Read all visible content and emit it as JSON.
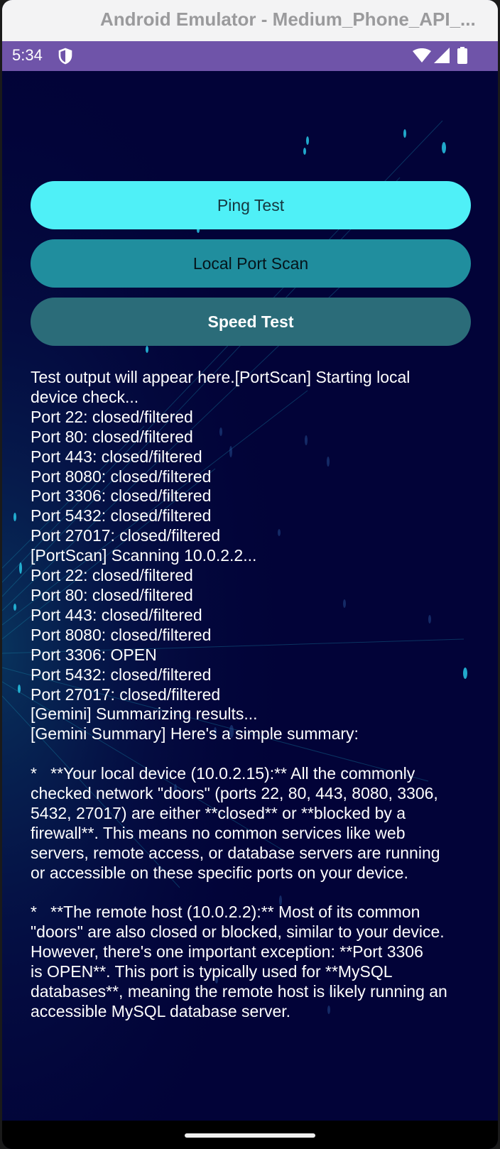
{
  "window": {
    "title": "Android Emulator - Medium_Phone_API_..."
  },
  "status_bar": {
    "time": "5:34",
    "icons": [
      "shield-icon",
      "wifi-icon",
      "signal-icon",
      "battery-icon"
    ],
    "color": "#6f54a9"
  },
  "colors": {
    "background": "#020338",
    "ping_button": "#4ff0f7",
    "port_scan_button": "#208e9e",
    "speed_test_button": "#2b6c79"
  },
  "buttons": {
    "ping": "Ping Test",
    "port_scan": "Local Port Scan",
    "speed_test": "Speed Test"
  },
  "output": {
    "lines": [
      "Test output will appear here.[PortScan] Starting local",
      "device check...",
      "Port 22: closed/filtered",
      "Port 80: closed/filtered",
      "Port 443: closed/filtered",
      "Port 8080: closed/filtered",
      "Port 3306: closed/filtered",
      "Port 5432: closed/filtered",
      "Port 27017: closed/filtered",
      "[PortScan] Scanning 10.0.2.2...",
      "Port 22: closed/filtered",
      "Port 80: closed/filtered",
      "Port 443: closed/filtered",
      "Port 8080: closed/filtered",
      "Port 3306: OPEN",
      "Port 5432: closed/filtered",
      "Port 27017: closed/filtered",
      "[Gemini] Summarizing results...",
      "[Gemini Summary] Here's a simple summary:",
      "",
      "*   **Your local device (10.0.2.15):** All the commonly",
      "checked network \"doors\" (ports 22, 80, 443, 8080, 3306,",
      "5432, 27017) are either **closed** or **blocked by a",
      "firewall**. This means no common services like web",
      "servers, remote access, or database servers are running",
      "or accessible on these specific ports on your device.",
      "",
      "*   **The remote host (10.0.2.2):** Most of its common",
      "\"doors\" are also closed or blocked, similar to your device.",
      "However, there's one important exception: **Port 3306",
      "is OPEN**. This port is typically used for **MySQL",
      "databases**, meaning the remote host is likely running an",
      "accessible MySQL database server."
    ]
  }
}
